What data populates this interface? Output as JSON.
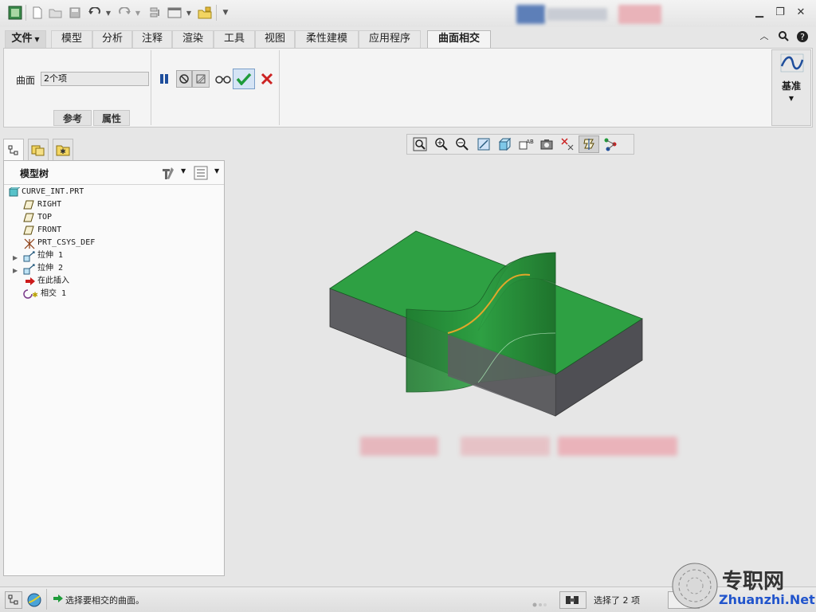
{
  "ribbon": {
    "tabs": [
      {
        "label": "文件",
        "id": "file"
      },
      {
        "label": "模型",
        "id": "model"
      },
      {
        "label": "分析",
        "id": "analysis"
      },
      {
        "label": "注释",
        "id": "annotate"
      },
      {
        "label": "渲染",
        "id": "render"
      },
      {
        "label": "工具",
        "id": "tools"
      },
      {
        "label": "视图",
        "id": "view"
      },
      {
        "label": "柔性建模",
        "id": "flex"
      },
      {
        "label": "应用程序",
        "id": "apps"
      },
      {
        "label": "曲面相交",
        "id": "intersect"
      }
    ],
    "surface_label": "曲面",
    "surface_value": "2个项",
    "sub_tabs": [
      "参考",
      "属性"
    ],
    "datum_label": "基准"
  },
  "panel": {
    "title": "模型树"
  },
  "tree": [
    {
      "label": "CURVE_INT.PRT",
      "icon": "part-icon",
      "indent": 0,
      "expandable": false
    },
    {
      "label": "RIGHT",
      "icon": "datum-plane-icon",
      "indent": 1,
      "expandable": false
    },
    {
      "label": "TOP",
      "icon": "datum-plane-icon",
      "indent": 1,
      "expandable": false
    },
    {
      "label": "FRONT",
      "icon": "datum-plane-icon",
      "indent": 1,
      "expandable": false
    },
    {
      "label": "PRT_CSYS_DEF",
      "icon": "csys-icon",
      "indent": 1,
      "expandable": false
    },
    {
      "label": "拉伸 1",
      "icon": "extrude-icon",
      "indent": 1,
      "expandable": true
    },
    {
      "label": "拉伸 2",
      "icon": "extrude-icon",
      "indent": 1,
      "expandable": true
    },
    {
      "label": "在此插入",
      "icon": "insert-here-arrow-icon",
      "indent": 1,
      "expandable": false
    },
    {
      "label": "相交 1",
      "icon": "intersect-icon",
      "indent": 1,
      "expandable": false
    }
  ],
  "status": {
    "message": "选择要相交的曲面。",
    "selection": "选择了 2 项",
    "watermark_cn": "专职网",
    "watermark_en": "Zhuanzhi.Net"
  },
  "colors": {
    "surface_green": "#2ea043",
    "solid_gray": "#5e5e62",
    "accent_blue": "#1f4e9c",
    "confirm_green": "#1e9b3a",
    "cancel_red": "#cc2222"
  }
}
